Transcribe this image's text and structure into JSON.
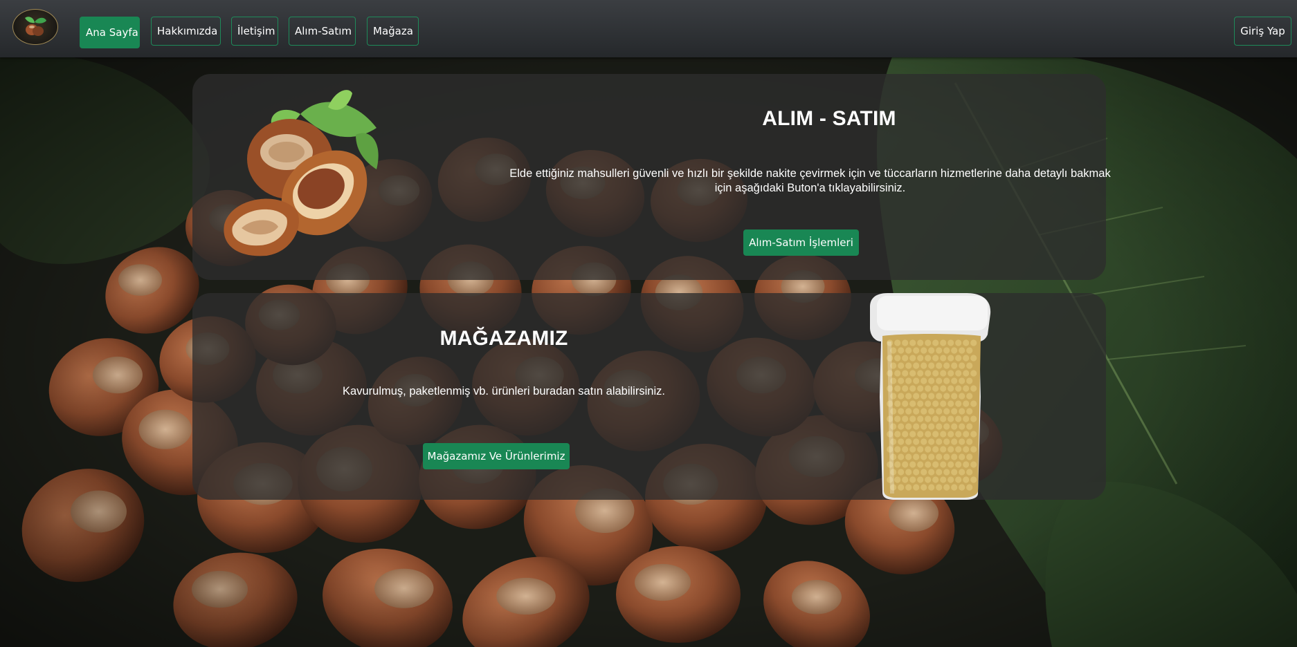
{
  "nav": {
    "logo_icon": "hazelnut-logo-icon",
    "items": [
      {
        "label": "Ana Sayfa",
        "active": true
      },
      {
        "label": "Hakkımızda",
        "active": false
      },
      {
        "label": "İletişim",
        "active": false
      },
      {
        "label": "Alım-Satım",
        "active": false
      },
      {
        "label": "Mağaza",
        "active": false
      }
    ],
    "login_label": "Giriş Yap"
  },
  "cards": {
    "alim_satim": {
      "title": "ALIM - SATIM",
      "description": "Elde ettiğiniz mahsulleri güvenli ve hızlı bir şekilde nakite çevirmek için ve tüccarların hizmetlerine daha detaylı bakmak için aşağıdaki Buton'a tıklayabilirsiniz.",
      "button_label": "Alım-Satım İşlemleri",
      "image_icon": "hazelnut-image"
    },
    "magaza": {
      "title": "MAĞAZAMIZ",
      "description": "Kavurulmuş, paketlenmiş vb. ürünleri buradan satın alabilirsiniz.",
      "button_label": "Mağazamız Ve Ürünlerimiz",
      "image_icon": "vacuum-pack-image"
    }
  },
  "colors": {
    "accent_green": "#198754",
    "navbar_bg": "#2e3135",
    "card_bg": "#2d2d2d"
  }
}
